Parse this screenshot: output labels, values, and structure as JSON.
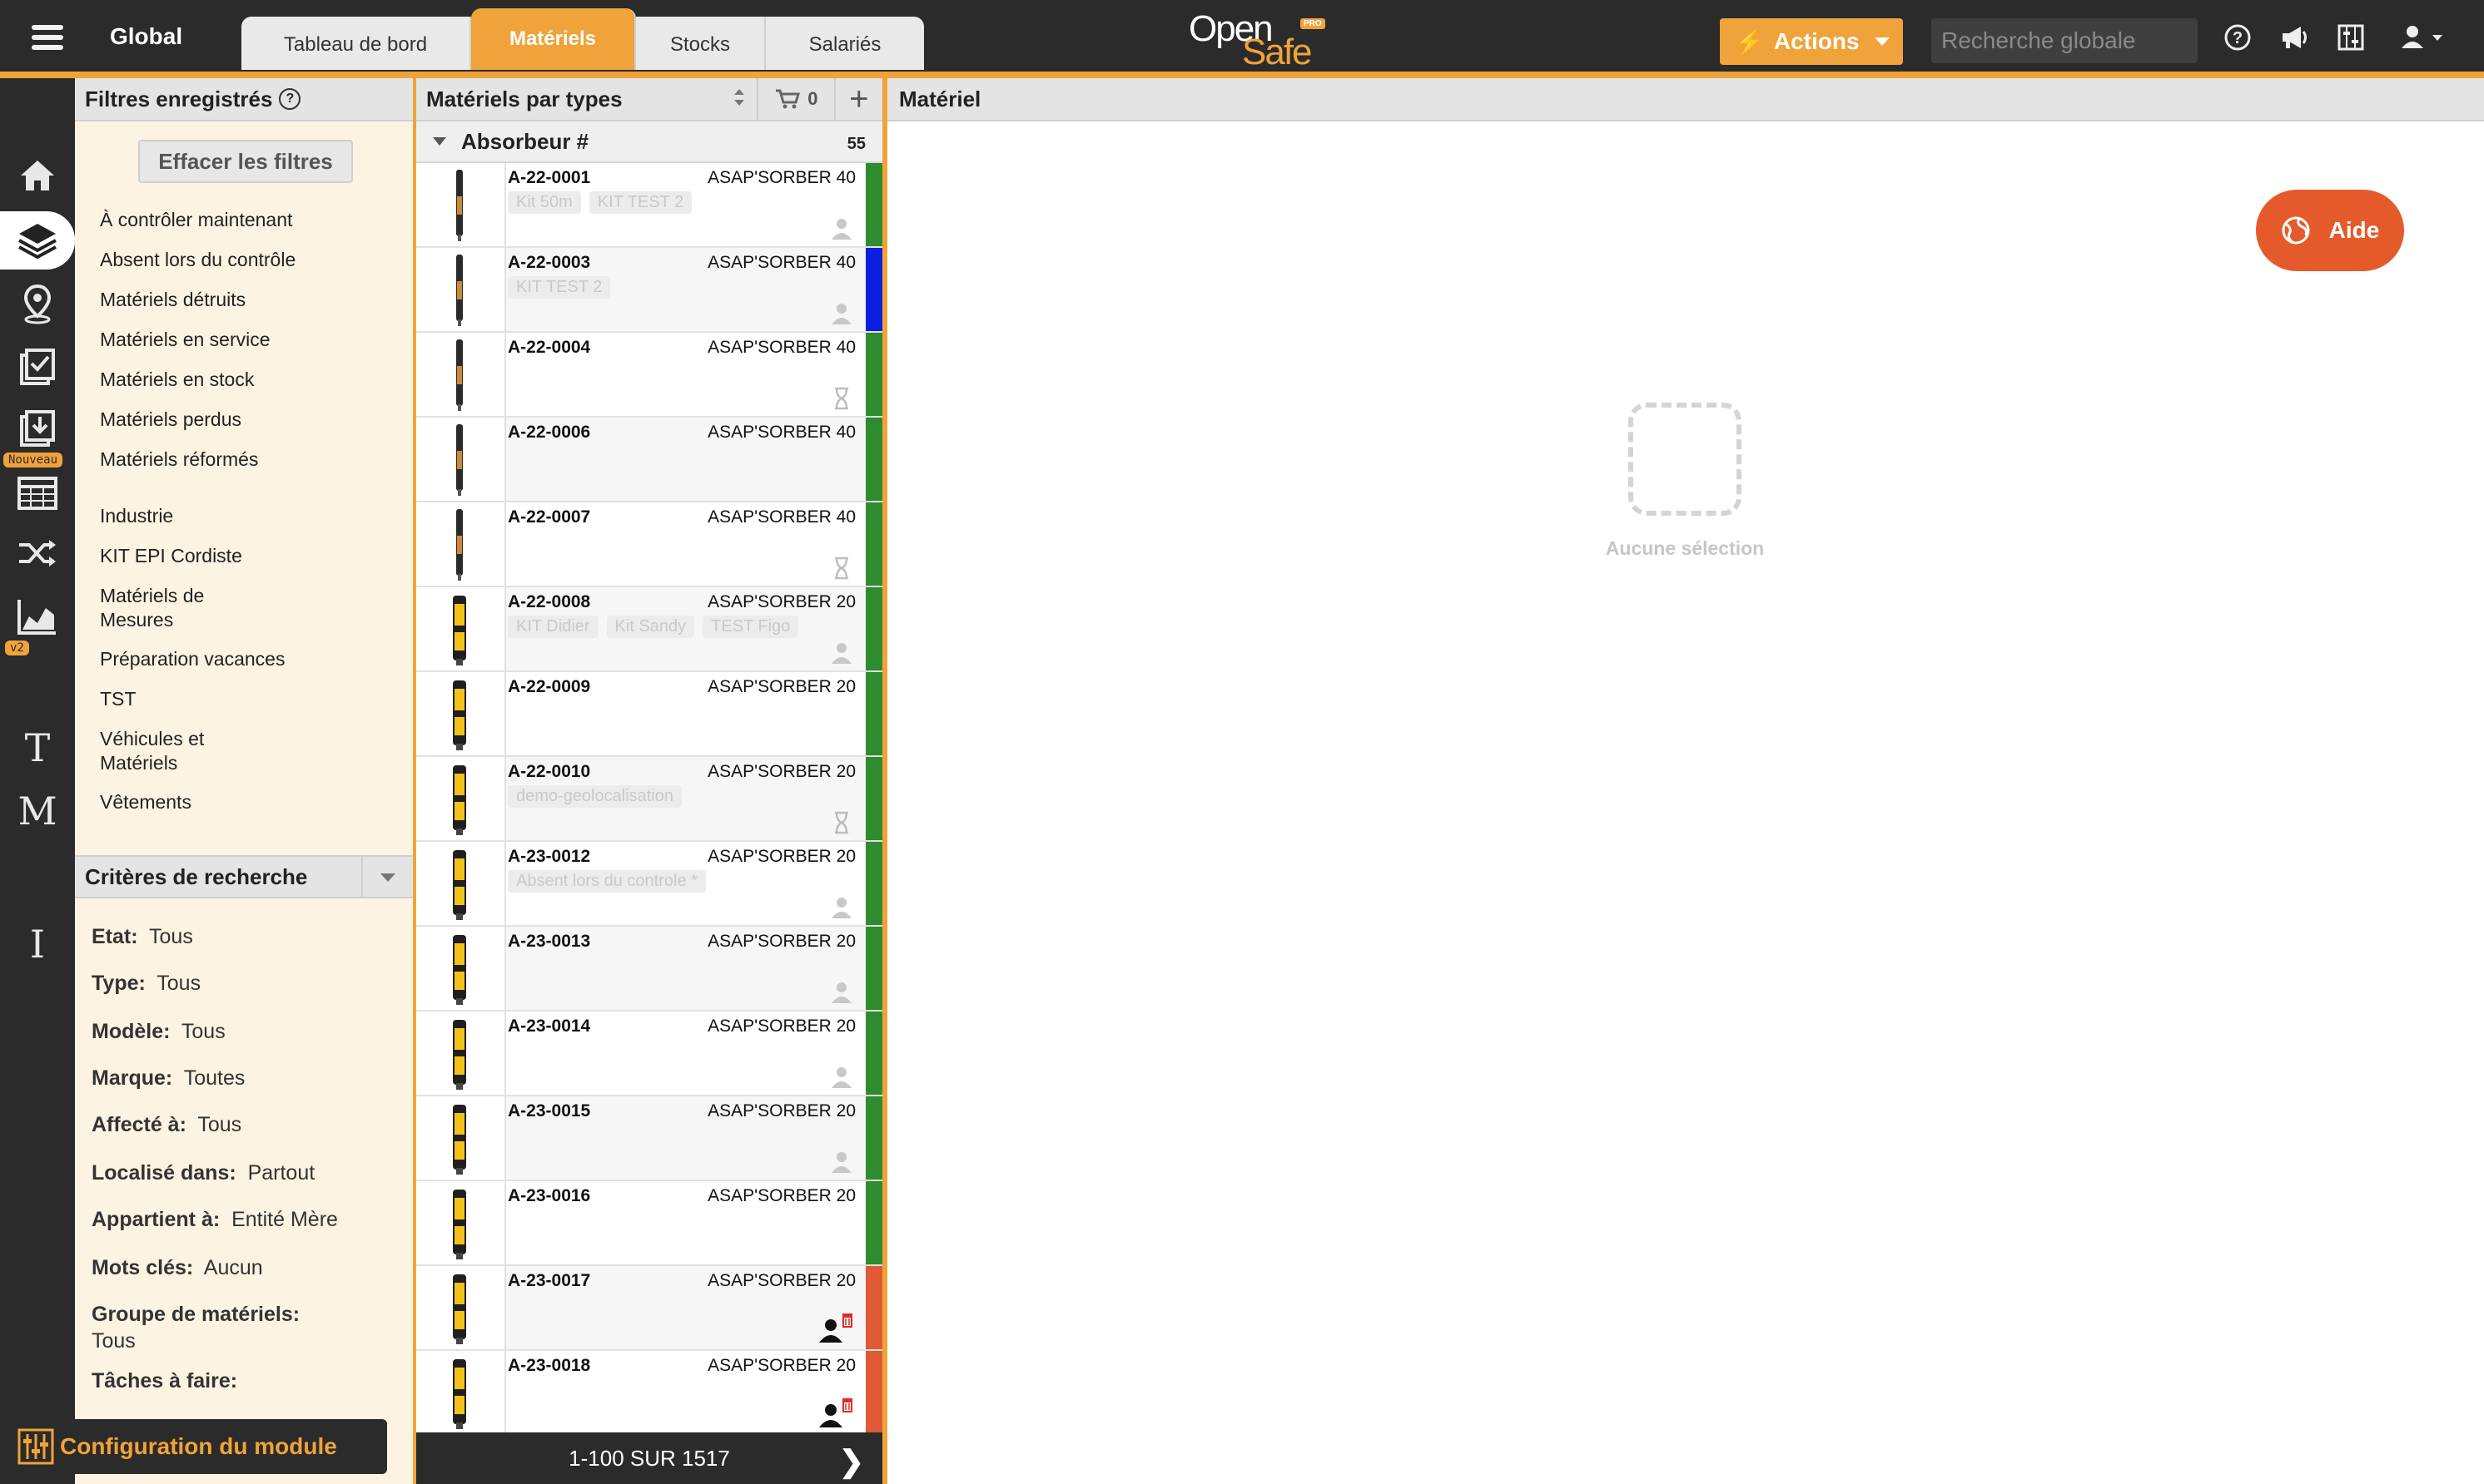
{
  "header": {
    "workspace": "Global",
    "tabs": [
      {
        "label": "Tableau de bord",
        "active": false
      },
      {
        "label": "Matériels",
        "active": true
      },
      {
        "label": "Stocks",
        "active": false
      },
      {
        "label": "Salariés",
        "active": false
      }
    ],
    "logo": {
      "part1": "Open",
      "part2": "Safe",
      "badge": "PRO"
    },
    "actions_label": "Actions",
    "search_placeholder": "Recherche globale",
    "accent_color": "#f0a33a"
  },
  "sidebar": {
    "badge_new": "Nouveau",
    "badge_v2": "v2",
    "letters": [
      "T",
      "M",
      "I"
    ],
    "config_label": "Configuration du module"
  },
  "filters": {
    "title": "Filtres enregistrés",
    "clear_label": "Effacer les filtres",
    "saved": [
      "À contrôler maintenant",
      "Absent lors du contrôle",
      "Matériels détruits",
      "Matériels en service",
      "Matériels en stock",
      "Matériels perdus",
      "Matériels réformés"
    ],
    "groups": [
      "Industrie",
      "KIT EPI Cordiste",
      "Matériels de Mesures",
      "Préparation vacances",
      "TST",
      "Véhicules et Matériels",
      "Vêtements"
    ]
  },
  "criteria": {
    "title": "Critères de recherche",
    "items": [
      {
        "label": "Etat:",
        "value": "Tous"
      },
      {
        "label": "Type:",
        "value": "Tous"
      },
      {
        "label": "Modèle:",
        "value": "Tous"
      },
      {
        "label": "Marque:",
        "value": "Toutes"
      },
      {
        "label": "Affecté à:",
        "value": "Tous"
      },
      {
        "label": "Localisé dans:",
        "value": "Partout"
      },
      {
        "label": "Appartient à:",
        "value": "Entité Mère"
      },
      {
        "label": "Mots clés:",
        "value": "Aucun"
      },
      {
        "label": "Groupe de matériels:",
        "value": "Tous"
      },
      {
        "label": "Tâches à faire:",
        "value": ""
      }
    ]
  },
  "list": {
    "title": "Matériels par types",
    "cart_count": "0",
    "group_name": "Absorbeur #",
    "group_count": "55",
    "items": [
      {
        "code": "A-22-0001",
        "model": "ASAP'SORBER 40",
        "tags": [
          "Kit 50m",
          "KIT TEST 2"
        ],
        "status": "#2e8b2e",
        "icon": "user-gray-icon"
      },
      {
        "code": "A-22-0003",
        "model": "ASAP'SORBER 40",
        "tags": [
          "KIT TEST 2"
        ],
        "status": "#0a1fe0",
        "icon": "user-gray-icon"
      },
      {
        "code": "A-22-0004",
        "model": "ASAP'SORBER 40",
        "tags": [],
        "status": "#2e8b2e",
        "icon": "hourglass-icon"
      },
      {
        "code": "A-22-0006",
        "model": "ASAP'SORBER 40",
        "tags": [],
        "status": "#2e8b2e",
        "icon": "none"
      },
      {
        "code": "A-22-0007",
        "model": "ASAP'SORBER 40",
        "tags": [],
        "status": "#2e8b2e",
        "icon": "hourglass-icon"
      },
      {
        "code": "A-22-0008",
        "model": "ASAP'SORBER 20",
        "tags": [
          "KIT Didier",
          "Kit Sandy",
          "TEST Figo"
        ],
        "status": "#2e8b2e",
        "icon": "user-gray-icon"
      },
      {
        "code": "A-22-0009",
        "model": "ASAP'SORBER 20",
        "tags": [],
        "status": "#2e8b2e",
        "icon": "none"
      },
      {
        "code": "A-22-0010",
        "model": "ASAP'SORBER 20",
        "tags": [
          "demo-geolocalisation"
        ],
        "status": "#2e8b2e",
        "icon": "hourglass-icon"
      },
      {
        "code": "A-23-0012",
        "model": "ASAP'SORBER 20",
        "tags": [
          "Absent lors du controle *"
        ],
        "status": "#2e8b2e",
        "icon": "user-gray-icon"
      },
      {
        "code": "A-23-0013",
        "model": "ASAP'SORBER 20",
        "tags": [],
        "status": "#2e8b2e",
        "icon": "user-gray-icon"
      },
      {
        "code": "A-23-0014",
        "model": "ASAP'SORBER 20",
        "tags": [],
        "status": "#2e8b2e",
        "icon": "user-gray-icon"
      },
      {
        "code": "A-23-0015",
        "model": "ASAP'SORBER 20",
        "tags": [],
        "status": "#2e8b2e",
        "icon": "user-gray-icon"
      },
      {
        "code": "A-23-0016",
        "model": "ASAP'SORBER 20",
        "tags": [],
        "status": "#2e8b2e",
        "icon": "none"
      },
      {
        "code": "A-23-0017",
        "model": "ASAP'SORBER 20",
        "tags": [],
        "status": "#e05a35",
        "icon": "user-trash-icon"
      },
      {
        "code": "A-23-0018",
        "model": "ASAP'SORBER 20",
        "tags": [],
        "status": "#e05a35",
        "icon": "user-trash-icon"
      }
    ],
    "pager": "1-100 SUR 1517"
  },
  "detail": {
    "title": "Matériel",
    "help_label": "Aide",
    "empty_label": "Aucune sélection"
  }
}
